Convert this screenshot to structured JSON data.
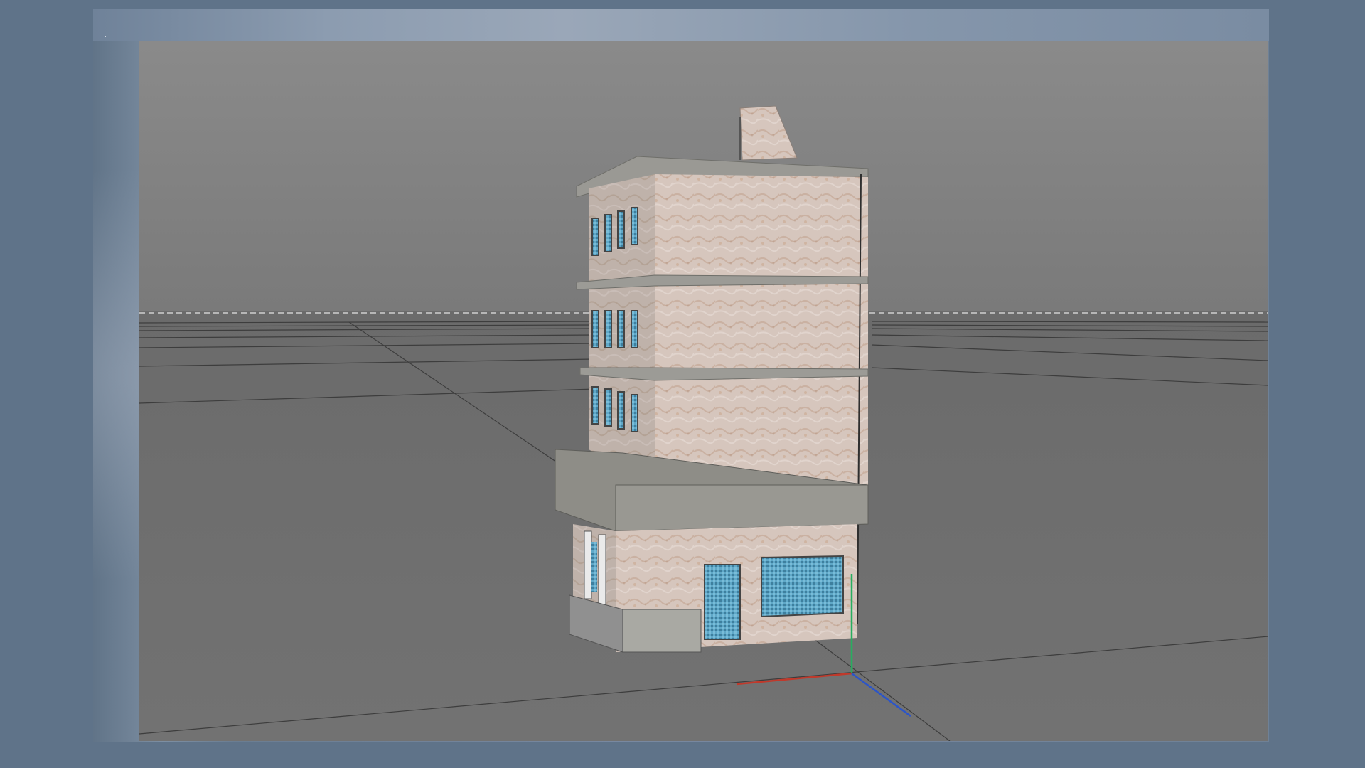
{
  "app": {
    "window_title": ""
  },
  "viewport": {
    "camera": "perspective",
    "background_color": "#7c7c7c",
    "horizon_color": "#bdbdbd",
    "scene_object": "building",
    "wall_texture": "marble",
    "window_color": "#5fa8c8"
  },
  "axes": {
    "x_color": "#c0392b",
    "y_color": "#27ae60",
    "z_color": "#2c55c8"
  }
}
